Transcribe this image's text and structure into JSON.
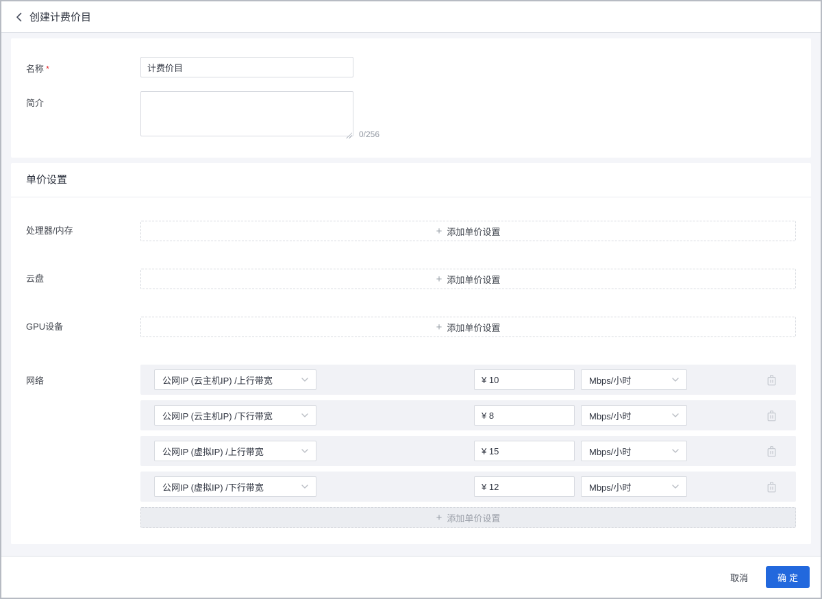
{
  "header": {
    "title": "创建计费价目"
  },
  "basic_form": {
    "name_label": "名称",
    "required_mark": "*",
    "name_value": "计费价目",
    "intro_label": "简介",
    "intro_value": "",
    "intro_counter": "0/256"
  },
  "price_section": {
    "title": "单价设置",
    "plus_sign": "+",
    "add_button_label": "添加单价设置",
    "simple_rows": [
      {
        "label": "处理器/内存"
      },
      {
        "label": "云盘"
      },
      {
        "label": "GPU设备"
      }
    ],
    "network": {
      "label": "网络",
      "rows": [
        {
          "type": "公网IP (云主机IP) /上行带宽",
          "price": "¥ 10",
          "unit": "Mbps/小时"
        },
        {
          "type": "公网IP (云主机IP) /下行带宽",
          "price": "¥ 8",
          "unit": "Mbps/小时"
        },
        {
          "type": "公网IP (虚拟IP) /上行带宽",
          "price": "¥ 15",
          "unit": "Mbps/小时"
        },
        {
          "type": "公网IP (虚拟IP) /下行带宽",
          "price": "¥ 12",
          "unit": "Mbps/小时"
        }
      ],
      "add_button_label": "添加单价设置"
    }
  },
  "footer": {
    "cancel_label": "取消",
    "confirm_label": "确定"
  },
  "colors": {
    "primary": "#2268dd",
    "required": "#e4393c",
    "stripe_bg": "#f1f2f6"
  }
}
